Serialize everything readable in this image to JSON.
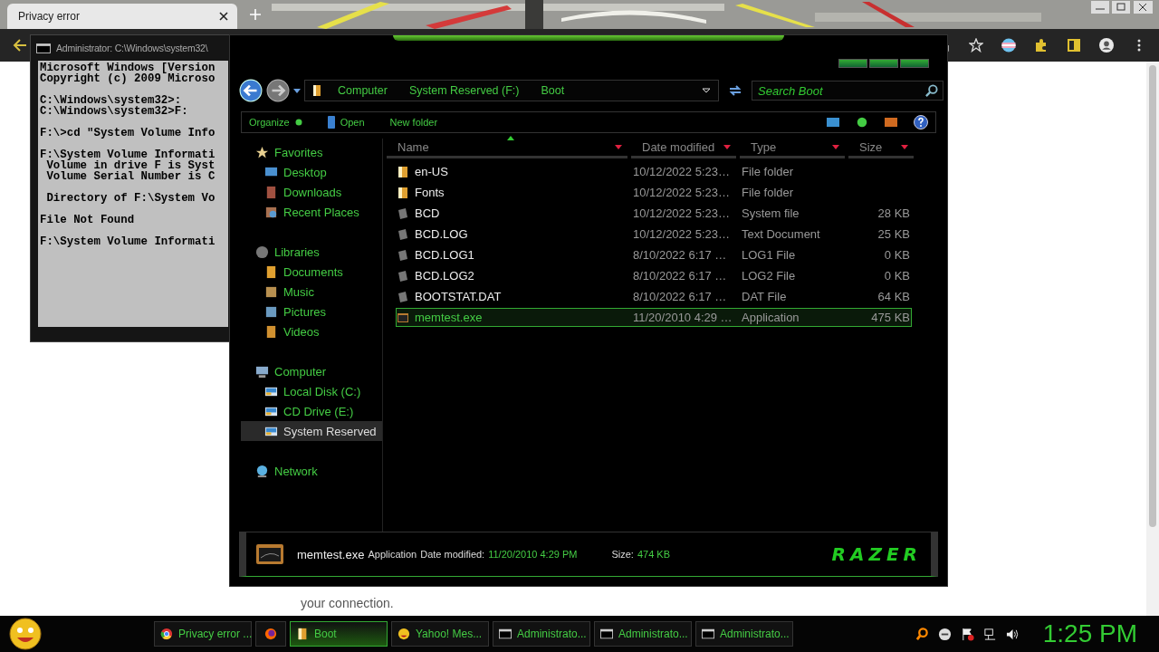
{
  "browser": {
    "tabs": [
      {
        "title": "Privacy error",
        "selected": true
      }
    ],
    "page_text": "your connection."
  },
  "cmd_window": {
    "title": "Administrator: C:\\Windows\\system32\\",
    "blocks": [
      [
        "Microsoft Windows [Version",
        "Copyright (c) 2009 Microso"
      ],
      [
        "C:\\Windows\\system32>:",
        "C:\\Windows\\system32>F:"
      ],
      [
        "F:\\>cd \"System Volume Info"
      ],
      [
        "F:\\System Volume Informati",
        " Volume in drive F is Syst",
        " Volume Serial Number is C"
      ],
      [
        " Directory of F:\\System Vo"
      ],
      [
        "File Not Found"
      ],
      [
        "F:\\System Volume Informati"
      ]
    ]
  },
  "explorer": {
    "breadcrumb": [
      "Computer",
      "System Reserved (F:)",
      "Boot"
    ],
    "search": {
      "placeholder": "Search Boot"
    },
    "toolbar": [
      "Organize",
      "Open",
      "New folder"
    ],
    "columns": [
      "Name",
      "Date modified",
      "Type",
      "Size"
    ],
    "sidebar": [
      {
        "label": "Favorites",
        "kind": "star",
        "selected": false,
        "children": [
          {
            "label": "Desktop",
            "kind": "desktop",
            "selected": false
          },
          {
            "label": "Downloads",
            "kind": "download",
            "selected": false
          },
          {
            "label": "Recent Places",
            "kind": "recent",
            "selected": false
          }
        ]
      },
      {
        "label": "Libraries",
        "kind": "library",
        "selected": false,
        "children": [
          {
            "label": "Documents",
            "kind": "doc",
            "selected": false
          },
          {
            "label": "Music",
            "kind": "music",
            "selected": false
          },
          {
            "label": "Pictures",
            "kind": "pictures",
            "selected": false
          },
          {
            "label": "Videos",
            "kind": "video",
            "selected": false
          }
        ]
      },
      {
        "label": "Computer",
        "kind": "computer",
        "selected": false,
        "children": [
          {
            "label": "Local Disk (C:)",
            "kind": "drive",
            "selected": false
          },
          {
            "label": "CD Drive (E:)",
            "kind": "drive",
            "selected": false
          },
          {
            "label": "System Reserved",
            "kind": "drive",
            "selected": true
          }
        ]
      },
      {
        "label": "Network",
        "kind": "network",
        "selected": false
      }
    ],
    "files": [
      {
        "name": "en-US",
        "date": "10/12/2022 5:23…",
        "type": "File folder",
        "kind": "folder",
        "selected": false
      },
      {
        "name": "Fonts",
        "date": "10/12/2022 5:23…",
        "type": "File folder",
        "kind": "folder",
        "selected": false
      },
      {
        "name": "BCD",
        "date": "10/12/2022 5:23…",
        "type": "System file",
        "size": "28 KB",
        "kind": "file",
        "selected": false
      },
      {
        "name": "BCD.LOG",
        "date": "10/12/2022 5:23…",
        "type": "Text Document",
        "size": "25 KB",
        "kind": "file",
        "selected": false
      },
      {
        "name": "BCD.LOG1",
        "date": "8/10/2022 6:17 …",
        "type": "LOG1 File",
        "size": "0 KB",
        "kind": "file",
        "selected": false
      },
      {
        "name": "BCD.LOG2",
        "date": "8/10/2022 6:17 …",
        "type": "LOG2 File",
        "size": "0 KB",
        "kind": "file",
        "selected": false
      },
      {
        "name": "BOOTSTAT.DAT",
        "date": "8/10/2022 6:17 …",
        "type": "DAT File",
        "size": "64 KB",
        "kind": "file",
        "selected": false
      },
      {
        "name": "memtest.exe",
        "date": "11/20/2010 4:29 …",
        "type": "Application",
        "size": "475 KB",
        "kind": "app",
        "selected": true
      }
    ],
    "details": {
      "name": "memtest.exe",
      "type": "Application",
      "date_label": "Date modified:",
      "date": "11/20/2010 4:29 PM",
      "size_label": "Size:",
      "size": "474 KB",
      "logo": "RAZER"
    }
  },
  "taskbar": {
    "items": [
      {
        "label": "Privacy error ...",
        "kind": "chrome",
        "selected": false
      },
      {
        "kind": "firefox",
        "selected": false
      },
      {
        "label": "Boot",
        "kind": "folder",
        "selected": true
      },
      {
        "label": "Yahoo! Mes...",
        "kind": "smiley",
        "selected": false
      },
      {
        "label": "Administrato...",
        "kind": "cmd",
        "selected": false
      },
      {
        "label": "Administrato...",
        "kind": "cmd",
        "selected": false
      },
      {
        "label": "Administrato...",
        "kind": "cmd",
        "selected": false
      }
    ],
    "clock": "1:25 PM"
  }
}
